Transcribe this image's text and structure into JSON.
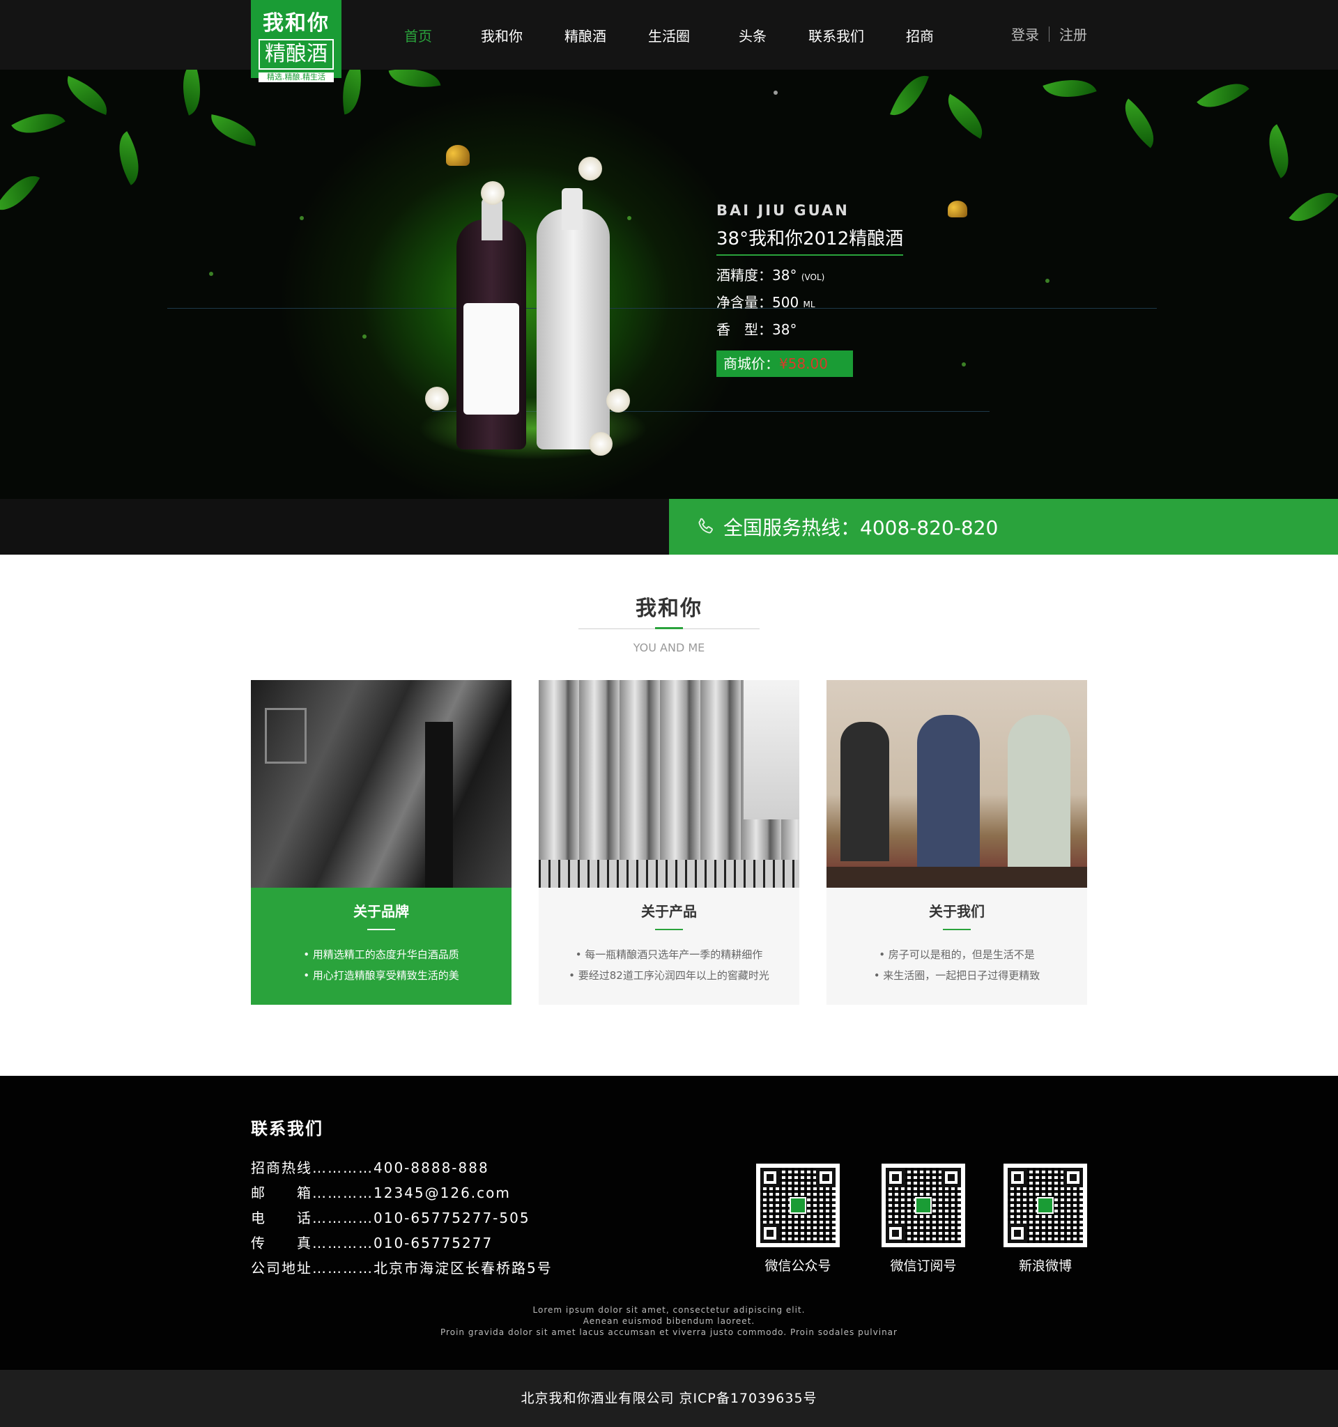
{
  "logo": {
    "line1": "我和你",
    "line2": "精酿酒",
    "line3": "精选.精酿.精生活"
  },
  "nav": {
    "items": [
      "首页",
      "我和你",
      "精酿酒",
      "生活圈",
      "头条",
      "联系我们",
      "招商"
    ]
  },
  "auth": {
    "login": "登录",
    "register": "注册"
  },
  "banner": {
    "en_title": "BAI JIU GUAN",
    "title": "38°我和你2012精酿酒",
    "specs": [
      {
        "label": "酒精度：",
        "value": "38°",
        "unit": "(VOL)"
      },
      {
        "label": "净含量：",
        "value": "500",
        "unit": "ML"
      },
      {
        "label": "香　型：",
        "value": "38°",
        "unit": ""
      }
    ],
    "price_label": "商城价：",
    "price_value": "¥58.00"
  },
  "hotline": {
    "text": "全国服务热线：4008-820-820",
    "icon": "phone-icon"
  },
  "about": {
    "title": "我和你",
    "subtitle": "YOU AND ME",
    "cards": [
      {
        "title": "关于品牌",
        "bullets": [
          "• 用精选精工的态度升华白酒品质",
          "• 用心打造精酿享受精致生活的美"
        ]
      },
      {
        "title": "关于产品",
        "bullets": [
          "• 每一瓶精酿酒只选年产一季的精耕细作",
          "• 要经过82道工序沁润四年以上的窖藏时光"
        ]
      },
      {
        "title": "关于我们",
        "bullets": [
          "• 房子可以是租的，但是生活不是",
          "• 来生活圈，一起把日子过得更精致"
        ]
      }
    ]
  },
  "footer": {
    "title": "联系我们",
    "contacts": [
      "招商热线…………400-8888-888",
      "邮　　箱…………12345@126.com",
      "电　　话…………010-65775277-505",
      "传　　真…………010-65775277",
      "公司地址…………北京市海淀区长春桥路5号"
    ],
    "qrs": [
      {
        "caption": "微信公众号"
      },
      {
        "caption": "微信订阅号"
      },
      {
        "caption": "新浪微博"
      }
    ],
    "lorem": [
      "Lorem ipsum dolor sit amet, consectetur adipiscing elit.",
      "Aenean euismod bibendum laoreet.",
      "Proin gravida dolor sit amet lacus accumsan et viverra justo commodo. Proin sodales pulvinar"
    ],
    "copyright": "北京我和你酒业有限公司 京ICP备17039635号"
  },
  "colors": {
    "brand_green": "#2aa33c",
    "header_bg": "#141414",
    "price_red": "#d83a2a"
  }
}
